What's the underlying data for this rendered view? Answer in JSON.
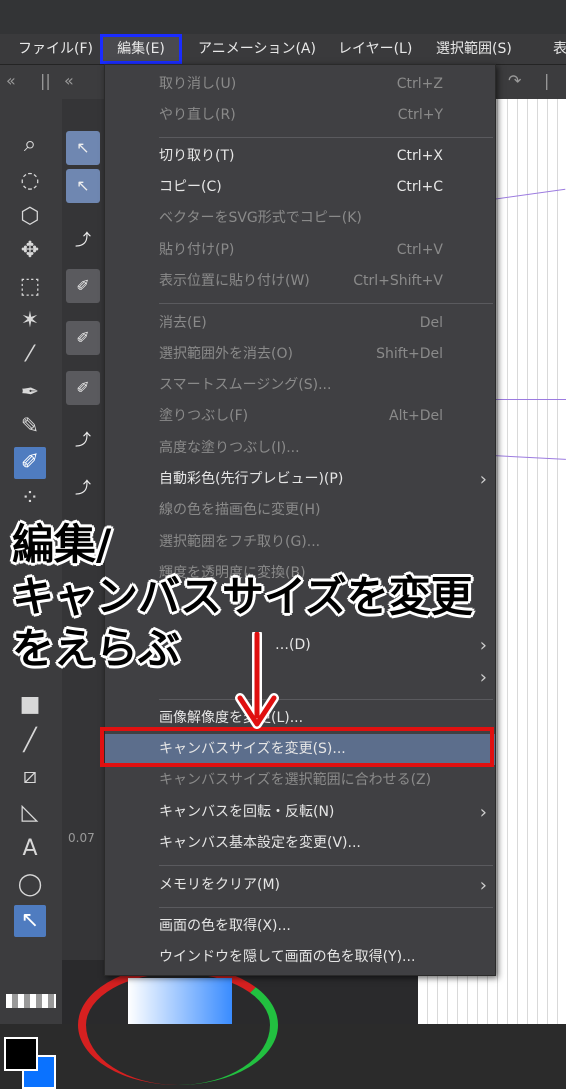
{
  "menubar": {
    "items": [
      "ファイル(F)",
      "編集(E)",
      "アニメーション(A)",
      "レイヤー(L)",
      "選択範囲(S)",
      "表"
    ],
    "active": "編集(E)"
  },
  "edit_menu": {
    "undo": {
      "label": "取り消し(U)",
      "shortcut": "Ctrl+Z"
    },
    "redo": {
      "label": "やり直し(R)",
      "shortcut": "Ctrl+Y"
    },
    "cut": {
      "label": "切り取り(T)",
      "shortcut": "Ctrl+X"
    },
    "copy": {
      "label": "コピー(C)",
      "shortcut": "Ctrl+C"
    },
    "copy_svg": {
      "label": "ベクターをSVG形式でコピー(K)"
    },
    "paste": {
      "label": "貼り付け(P)",
      "shortcut": "Ctrl+V"
    },
    "paste_in_place": {
      "label": "表示位置に貼り付け(W)",
      "shortcut": "Ctrl+Shift+V"
    },
    "clear": {
      "label": "消去(E)",
      "shortcut": "Del"
    },
    "clear_outside": {
      "label": "選択範囲外を消去(O)",
      "shortcut": "Shift+Del"
    },
    "smart_smoothing": {
      "label": "スマートスムージング(S)..."
    },
    "fill": {
      "label": "塗りつぶし(F)",
      "shortcut": "Alt+Del"
    },
    "advanced_fill": {
      "label": "高度な塗りつぶし(I)..."
    },
    "auto_color": {
      "label": "自動彩色(先行プレビュー)(P)"
    },
    "change_line_color": {
      "label": "線の色を描画色に変更(H)"
    },
    "border_selection": {
      "label": "選択範囲をフチ取り(G)..."
    },
    "brightness_transparency": {
      "label": "輝度を透明度に変換(B)"
    },
    "hidden_item_a": {
      "label": "…(D)"
    },
    "image_resolution": {
      "label": "画像解像度を変更(L)..."
    },
    "change_canvas_size": {
      "label": "キャンバスサイズを変更(S)..."
    },
    "fit_canvas_to_selection": {
      "label": "キャンバスサイズを選択範囲に合わせる(Z)"
    },
    "rotate_flip_canvas": {
      "label": "キャンバスを回転・反転(N)"
    },
    "canvas_basic_settings": {
      "label": "キャンバス基本設定を変更(V)..."
    },
    "clear_memory": {
      "label": "メモリをクリア(M)"
    },
    "pick_screen_color": {
      "label": "画面の色を取得(X)..."
    },
    "hide_window_pick_color": {
      "label": "ウインドウを隠して画面の色を取得(Y)..."
    }
  },
  "annotation": {
    "line1": "編集/",
    "line2": "キャンバスサイズを変更",
    "line3": "をえらぶ"
  },
  "panel_values": {
    "value_1": "0.07"
  },
  "colors": {
    "highlight_box": "#e01010",
    "active_menu_border": "#1a2cff",
    "annotation_arrow": "#e01010"
  },
  "icons": [
    "zoom-icon",
    "move-icon",
    "select-icon",
    "eyedropper-icon",
    "pen-icon",
    "text-icon"
  ]
}
